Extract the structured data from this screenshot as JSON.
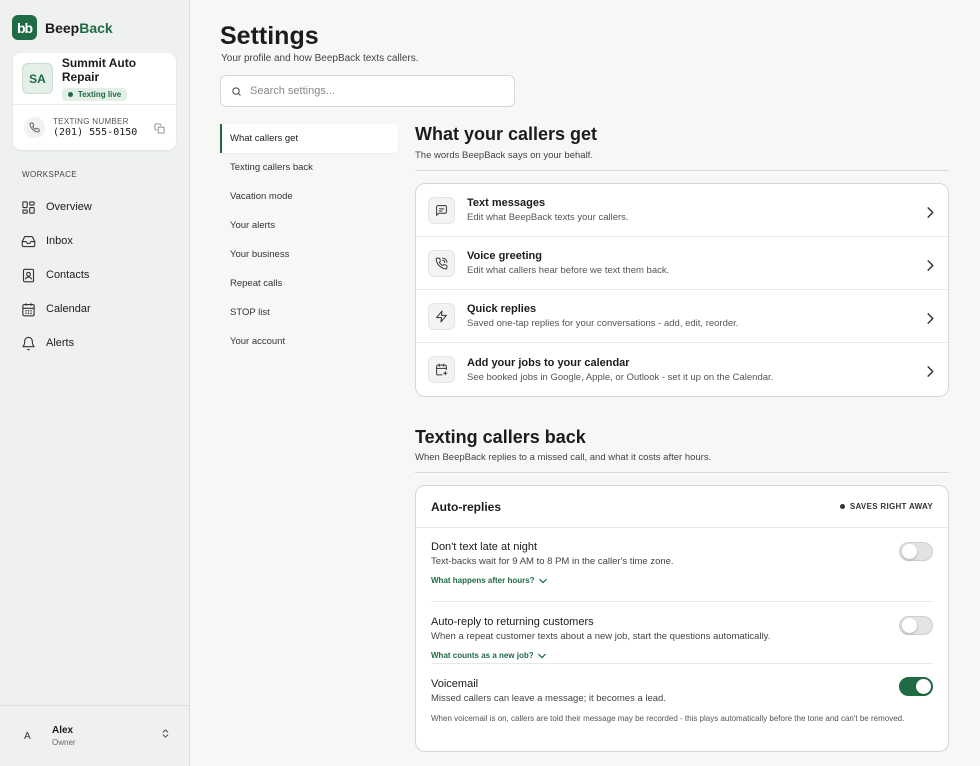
{
  "brand": {
    "logo_text": "bb",
    "name_part1": "Beep",
    "name_part2": "Back"
  },
  "account": {
    "avatar": "SA",
    "name": "Summit Auto Repair",
    "status": "Texting live",
    "texting_label": "TEXTING NUMBER",
    "texting_number": "(201) 555-0150"
  },
  "sidebar": {
    "section_label": "WORKSPACE",
    "items": [
      {
        "label": "Overview",
        "icon": "grid-icon"
      },
      {
        "label": "Inbox",
        "icon": "inbox-icon"
      },
      {
        "label": "Contacts",
        "icon": "contact-icon"
      },
      {
        "label": "Calendar",
        "icon": "calendar-icon"
      },
      {
        "label": "Alerts",
        "icon": "bell-icon"
      }
    ]
  },
  "user": {
    "avatar": "A",
    "name": "Alex",
    "role": "Owner"
  },
  "page": {
    "title": "Settings",
    "subtitle": "Your profile and how BeepBack texts callers.",
    "search_placeholder": "Search settings..."
  },
  "subnav": {
    "items": [
      "What callers get",
      "Texting callers back",
      "Vacation mode",
      "Your alerts",
      "Your business",
      "Repeat calls",
      "STOP list",
      "Your account"
    ],
    "active": 0
  },
  "section1": {
    "title": "What your callers get",
    "subtitle": "The words BeepBack says on your behalf.",
    "rows": [
      {
        "title": "Text messages",
        "desc": "Edit what BeepBack texts your callers.",
        "icon": "message-icon"
      },
      {
        "title": "Voice greeting",
        "desc": "Edit what callers hear before we text them back.",
        "icon": "phone-call-icon"
      },
      {
        "title": "Quick replies",
        "desc": "Saved one-tap replies for your conversations - add, edit, reorder.",
        "icon": "lightning-icon"
      },
      {
        "title": "Add your jobs to your calendar",
        "desc": "See booked jobs in Google, Apple, or Outlook - set it up on the Calendar.",
        "icon": "calendar-plus-icon"
      }
    ]
  },
  "section2": {
    "title": "Texting callers back",
    "subtitle": "When BeepBack replies to a missed call, and what it costs after hours.",
    "card_title": "Auto-replies",
    "saves_label": "SAVES RIGHT AWAY",
    "settings": [
      {
        "title": "Don't text late at night",
        "desc": "Text-backs wait for 9 AM to 8 PM in the caller's time zone.",
        "link": "What happens after hours?",
        "enabled": false
      },
      {
        "title": "Auto-reply to returning customers",
        "desc": "When a repeat customer texts about a new job, start the questions automatically.",
        "link": "What counts as a new job?",
        "enabled": false
      },
      {
        "title": "Voicemail",
        "desc": "Missed callers can leave a message; it becomes a lead.",
        "note": "When voicemail is on, callers are told their message may be recorded - this plays automatically before the tone and can't be removed.",
        "enabled": true
      }
    ]
  },
  "colors": {
    "accent": "#1f6b45",
    "accent_light": "#e4efe8"
  }
}
